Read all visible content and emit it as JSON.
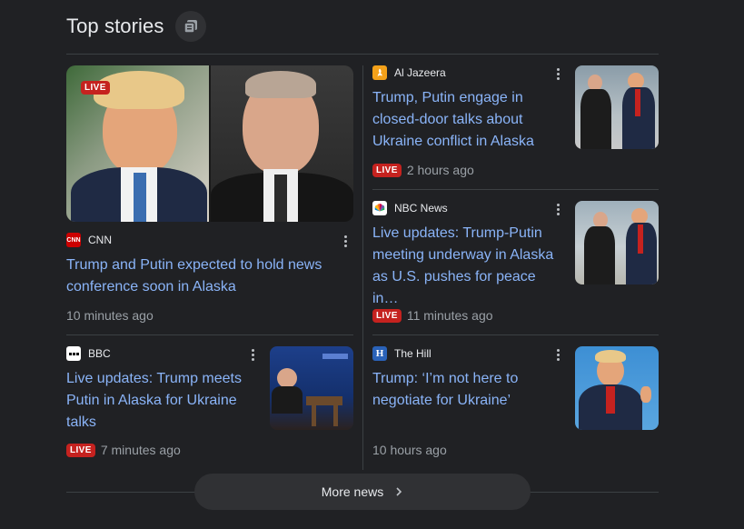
{
  "header": {
    "title": "Top stories"
  },
  "hero": {
    "badge": "LIVE",
    "source": "CNN",
    "headline": "Trump and Putin expected to hold news conference soon in Alaska",
    "time": "10 minutes ago"
  },
  "bbc": {
    "source": "BBC",
    "headline": "Live updates: Trump meets Putin in Alaska for Ukraine talks",
    "badge": "LIVE",
    "time": "7 minutes ago"
  },
  "aljazeera": {
    "source": "Al Jazeera",
    "headline": "Trump, Putin engage in closed-door talks about Ukraine conflict in Alaska",
    "badge": "LIVE",
    "time": "2 hours ago"
  },
  "nbc": {
    "source": "NBC News",
    "headline": "Live updates: Trump-Putin meeting underway in Alaska as U.S. pushes for peace in…",
    "badge": "LIVE",
    "time": "11 minutes ago"
  },
  "thehill": {
    "source": "The Hill",
    "headline": "Trump: ‘I’m not here to negotiate for Ukraine’",
    "time": "10 hours ago"
  },
  "footer": {
    "more_label": "More news"
  },
  "colors": {
    "link": "#8ab4f8",
    "live": "#c5221f",
    "background": "#202124"
  },
  "icons": {
    "header_button": "collection-icon",
    "kebab": "more-vert-icon",
    "chevron": "chevron-right-icon"
  }
}
